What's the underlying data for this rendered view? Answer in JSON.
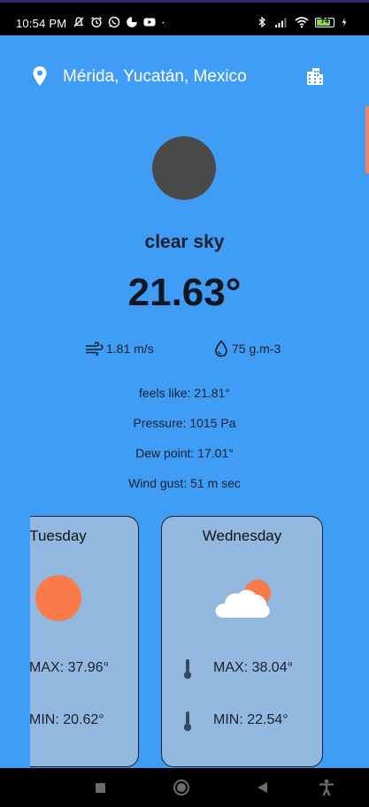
{
  "status_bar": {
    "time": "10:54 PM",
    "battery_level": "74",
    "left_icons": [
      "muted-notification-icon",
      "alarm-icon",
      "whatsapp-icon",
      "pie-icon",
      "youtube-icon",
      "dot-icon"
    ],
    "right_icons": [
      "bluetooth-icon",
      "signal-icon",
      "wifi-icon",
      "battery-icon",
      "charging-icon"
    ]
  },
  "header": {
    "location": "Mérida, Yucatán, Mexico",
    "location_icon": "location-pin-icon",
    "city_icon": "city-buildings-icon"
  },
  "current": {
    "condition": "clear sky",
    "temperature": "21.63°",
    "wind": "1.81 m/s",
    "humidity": "75 g.m-3",
    "feels_like": "feels like: 21.81°",
    "pressure": "Pressure: 1015 Pa",
    "dew_point": "Dew point: 17.01°",
    "wind_gust": "Wind gust: 51 m sec"
  },
  "forecast": [
    {
      "day": "Tuesday",
      "max": "MAX: 37.96°",
      "min": "MIN: 20.62°",
      "icon": "sun-icon"
    },
    {
      "day": "Wednesday",
      "max": "MAX: 38.04°",
      "min": "MIN: 22.54°",
      "icon": "partly-cloudy-icon"
    }
  ],
  "colors": {
    "background": "#3f9df6",
    "card": "#93b8df",
    "sun": "#f97b4a",
    "text_dark": "#1b1f2a"
  }
}
